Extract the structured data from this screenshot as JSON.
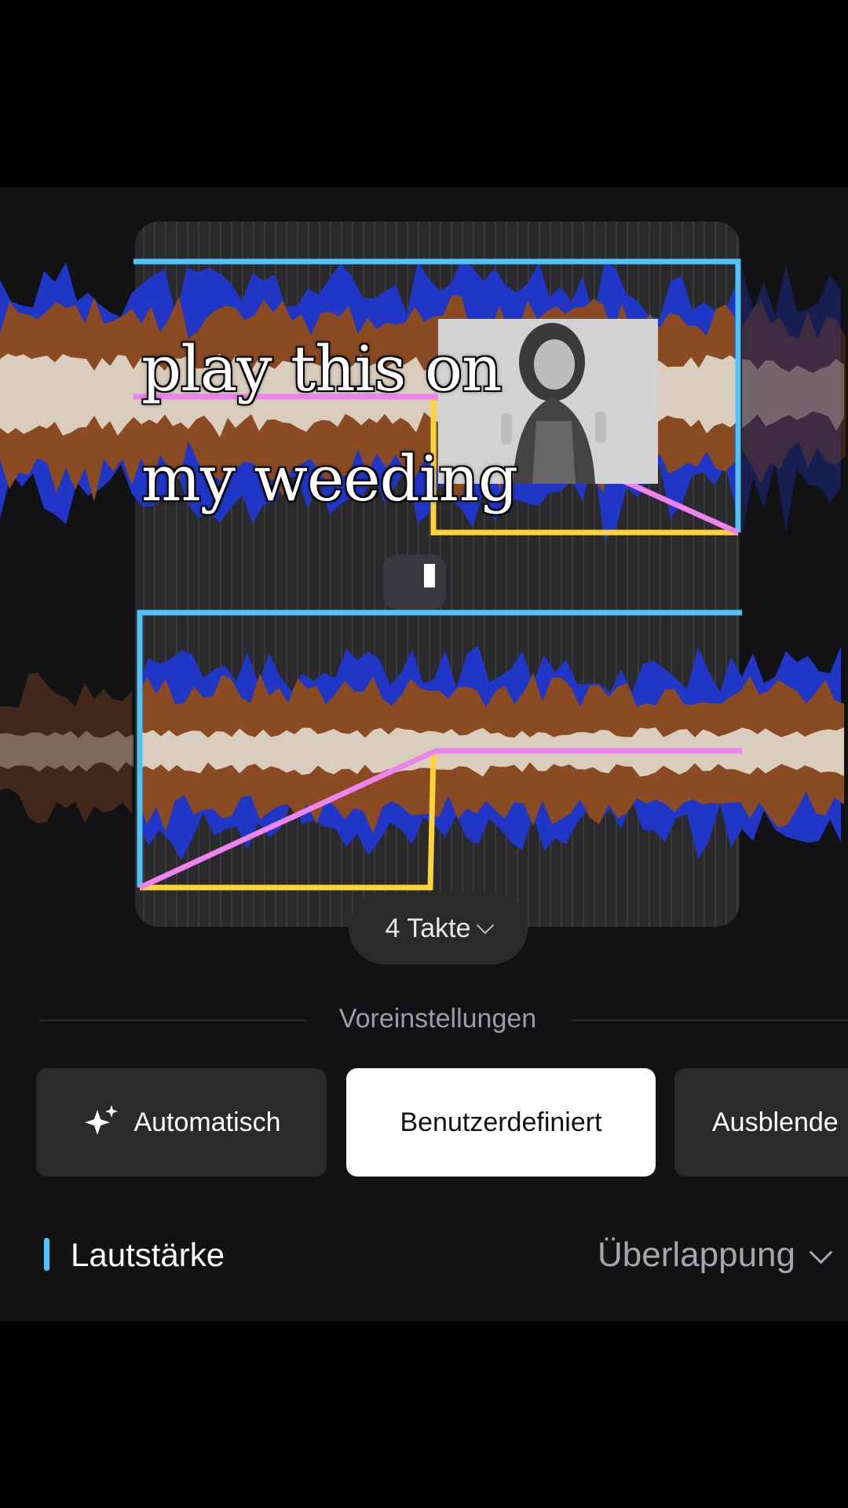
{
  "caption": {
    "line1": "play this on",
    "line2": "my weeding"
  },
  "editor": {
    "beats_label": "4 Takte",
    "colors": {
      "track_outline": "#4fc3f7",
      "fade_curve": "#ee82ee",
      "cut_line": "#ffd43b",
      "wave_blue": "#1f36c7",
      "wave_brown": "#8a4a22",
      "wave_cream": "#d9cdbd"
    }
  },
  "presets": {
    "title": "Voreinstellungen",
    "items": [
      {
        "label": "Automatisch",
        "icon": "sparkle-icon",
        "active": false
      },
      {
        "label": "Benutzerdefiniert",
        "active": true
      },
      {
        "label": "Ausblende",
        "active": false
      }
    ]
  },
  "volume": {
    "label": "Lautstärke",
    "mode": "Überlappung"
  }
}
